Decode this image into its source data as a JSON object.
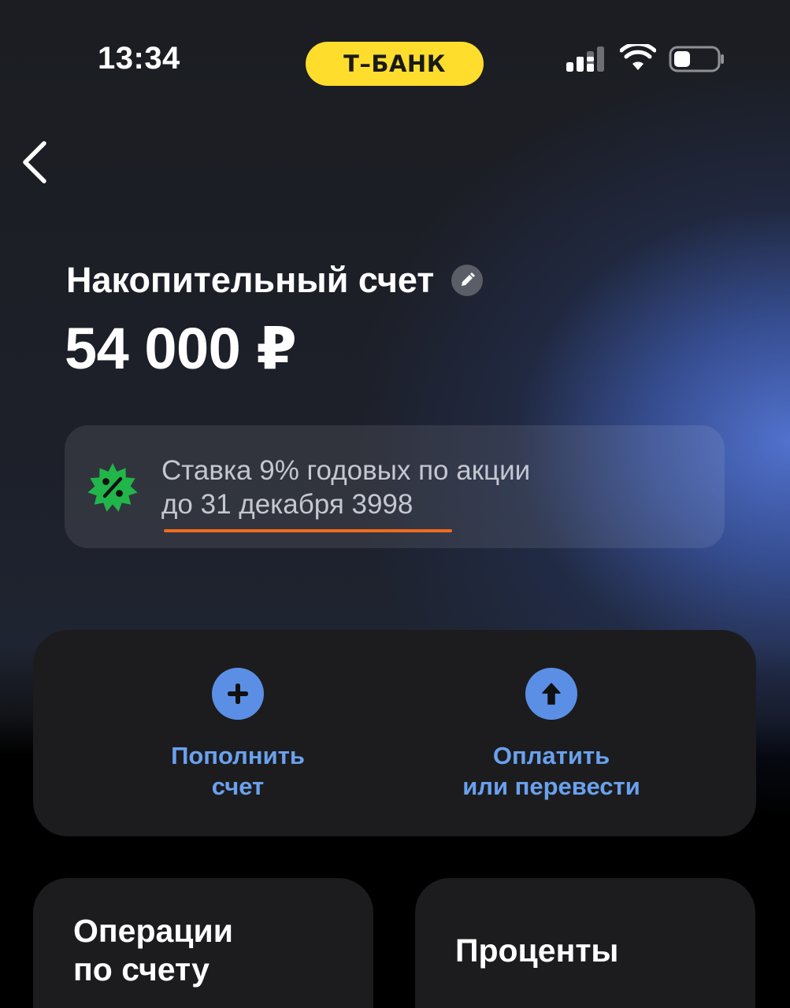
{
  "status_bar": {
    "time": "13:34",
    "bank_pill": "Т–БАНК",
    "icons": [
      "signal-icon",
      "wifi-icon",
      "battery-icon"
    ]
  },
  "nav": {
    "back_icon": "chevron-left-icon"
  },
  "account": {
    "title": "Накопительный счет",
    "edit_icon": "pencil-icon",
    "balance": "54 000 ₽"
  },
  "promo": {
    "icon": "percent-badge-icon",
    "line1": "Ставка 9% годовых по акции",
    "line2": "до 31 декабря 3998"
  },
  "actions": [
    {
      "icon": "plus-icon",
      "label_line1": "Пополнить",
      "label_line2": "счет"
    },
    {
      "icon": "arrow-up-icon",
      "label_line1": "Оплатить",
      "label_line2": "или перевести"
    }
  ],
  "cards": [
    {
      "title_line1": "Операции",
      "title_line2": "по счету"
    },
    {
      "title_line1": "Проценты"
    }
  ],
  "colors": {
    "pill": "#ffdd2d",
    "accent_blue": "#6aa1ee",
    "icon_blue": "#5b8fe6",
    "promo_green": "#21b54a",
    "underline_orange": "#f26a1b",
    "card_bg": "#1c1c1e"
  }
}
